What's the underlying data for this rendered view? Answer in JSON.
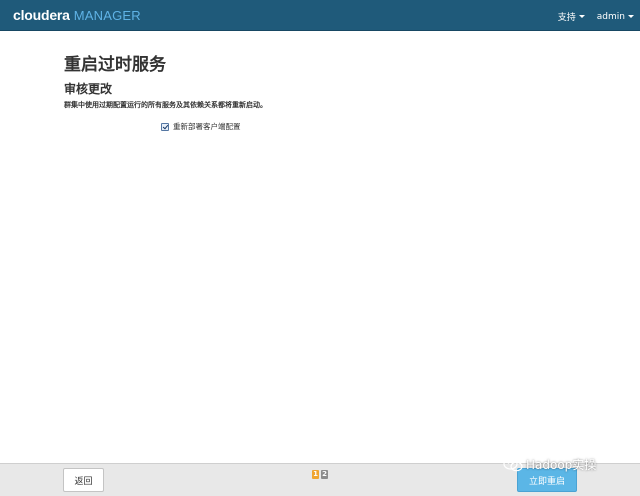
{
  "header": {
    "brand_main": "cloudera",
    "brand_sub": "MANAGER",
    "support_label": "支持",
    "admin_label": "admin"
  },
  "main": {
    "page_title": "重启过时服务",
    "section_title": "审核更改",
    "description": "群集中使用过期配置运行的所有服务及其依赖关系都将重新启动。",
    "checkbox_label": "重新部署客户端配置",
    "checkbox_checked": true
  },
  "footer": {
    "back_label": "返回",
    "steps": [
      "1",
      "2"
    ],
    "current_step": 1,
    "restart_label": "立即重启"
  },
  "watermark": {
    "text": "Hadoop实操"
  },
  "colors": {
    "header_bg": "#1f5a7a",
    "brand_accent": "#5fb3e6",
    "primary_button": "#5bb6e6",
    "step_active": "#f0a530",
    "step_inactive": "#8c8c8c",
    "footer_bg": "#e8e8e8"
  },
  "icons": {
    "watermark_icon": "wechat-icon",
    "dropdown_icon": "caret-down-icon"
  }
}
